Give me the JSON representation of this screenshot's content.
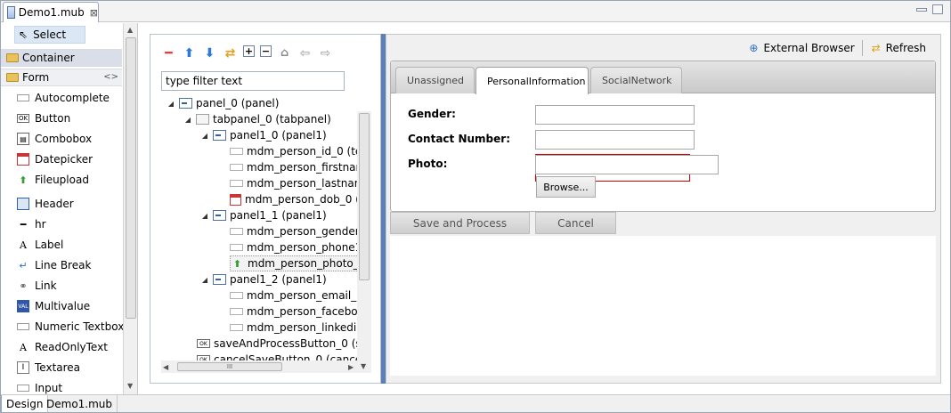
{
  "editor": {
    "tab_title": "Demo1.mub",
    "close_glyph": "⊠"
  },
  "palette": {
    "select_label": "Select",
    "categories": {
      "container": "Container",
      "form": "Form"
    },
    "collapse_glyph": "<>",
    "items": [
      "Autocomplete",
      "Button",
      "Combobox",
      "Datepicker",
      "Fileupload",
      "Header",
      "hr",
      "Label",
      "Line Break",
      "Link",
      "Multivalue",
      "Numeric Textbox",
      "ReadOnlyText",
      "Textarea",
      "Input"
    ]
  },
  "outline": {
    "filter_placeholder": "type filter text",
    "scroll_glyph": "III",
    "tree": [
      "panel_0 (panel)",
      "tabpanel_0 (tabpanel)",
      "panel1_0 (panel1)",
      "mdm_person_id_0 (tex",
      "mdm_person_firstnam",
      "mdm_person_lastnam",
      "mdm_person_dob_0 (c",
      "panel1_1 (panel1)",
      "mdm_person_gender_",
      "mdm_person_phone1_",
      "mdm_person_photo_0",
      "panel1_2 (panel1)",
      "mdm_person_email_0",
      "mdm_person_faceboo",
      "mdm_person_linkedin",
      "saveAndProcessButton_0 (sav",
      "cancelSaveButton_0 (cancelSa"
    ],
    "button_glyph": "OK"
  },
  "preview": {
    "external_browser": "External Browser",
    "refresh": "Refresh",
    "tabs": [
      "Unassigned",
      "PersonalInformation",
      "SocialNetwork"
    ],
    "active_tab": "PersonalInformation",
    "form": {
      "gender_label": "Gender:",
      "contact_label": "Contact Number:",
      "photo_label": "Photo:",
      "browse_label": "Browse..."
    },
    "save_label": "Save and Process",
    "cancel_label": "Cancel"
  },
  "bottom_tabs": [
    "Design",
    "Demo1.mub"
  ],
  "colors": {
    "splitter": "#5b7fb8",
    "photo_highlight": "#d00000",
    "palette_selection": "#dce7f5"
  }
}
